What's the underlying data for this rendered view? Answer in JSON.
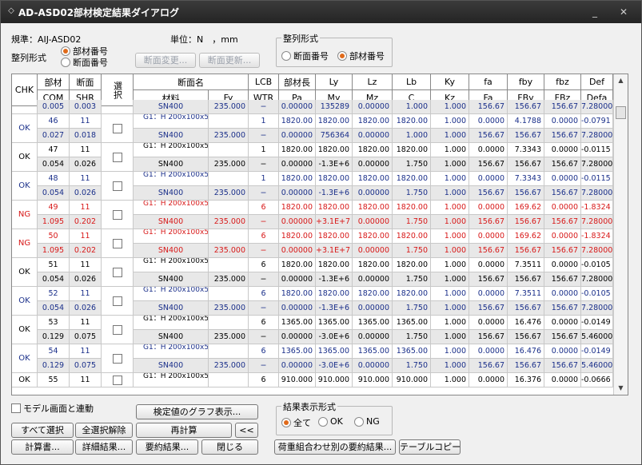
{
  "window": {
    "title": "AD-ASD02部材検定結果ダイアログ"
  },
  "top": {
    "standard": "規準：AIJ-ASD02",
    "unit": "単位：N　，mm",
    "sort_label": "整列形式",
    "radio1": "部材番号",
    "radio2": "断面番号",
    "btn_change": "断面変更...",
    "btn_update": "断面更新..."
  },
  "sortgroup": {
    "label": "整列形式",
    "opt1": "断面番号",
    "opt2": "部材番号",
    "selected": "部材番号"
  },
  "headers": {
    "top": [
      "CHK",
      "部材",
      "断面",
      "選択",
      "断面名",
      "LCB",
      "部材長",
      "Ly",
      "Lz",
      "Lb",
      "Ky",
      "fa",
      "fby",
      "fbz",
      "Def"
    ],
    "bottom": [
      "COM",
      "SHR",
      "材料",
      "Fy",
      "WTR",
      "Pa",
      "My",
      "Mz",
      "C",
      "Kz",
      "Fa",
      "FBy",
      "FBz",
      "Defa"
    ]
  },
  "rows": [
    {
      "chk": "",
      "color": "blue",
      "a": {
        "mem": "0.005",
        "sec": "0.003",
        "name": "SN400",
        "fy": "235.000",
        "lcb": "−",
        "l": "0.00000",
        "ly": "135289",
        "lz": "0.00000",
        "lb": "1.000",
        "ky": "1.000",
        "fa": "156.67",
        "fby": "156.67",
        "fbz": "156.67",
        "def": "7.28000"
      },
      "partial": true
    },
    {
      "chk": "OK",
      "color": "blue",
      "a": {
        "mem": "46",
        "sec": "11",
        "name": "G1：H 200x100x5.5/8, H=200x100x5.5x8",
        "fy": "",
        "lcb": "1",
        "l": "1820.00",
        "ly": "1820.00",
        "lz": "1820.00",
        "lb": "1820.00",
        "ky": "1.000",
        "fa": "0.0000",
        "fby": "4.1788",
        "fbz": "0.0000",
        "def": "-0.0791"
      },
      "b": {
        "mem": "0.027",
        "sec": "0.018",
        "name": "SN400",
        "fy": "235.000",
        "lcb": "−",
        "l": "0.00000",
        "ly": "756364",
        "lz": "0.00000",
        "lb": "1.000",
        "ky": "1.000",
        "fa": "156.67",
        "fby": "156.67",
        "fbz": "156.67",
        "def": "7.28000"
      }
    },
    {
      "chk": "OK",
      "color": "black",
      "a": {
        "mem": "47",
        "sec": "11",
        "name": "G1：H 200x100x5.5/8, H=200x100x5.5x8",
        "fy": "",
        "lcb": "1",
        "l": "1820.00",
        "ly": "1820.00",
        "lz": "1820.00",
        "lb": "1820.00",
        "ky": "1.000",
        "fa": "0.0000",
        "fby": "7.3343",
        "fbz": "0.0000",
        "def": "-0.0115"
      },
      "b": {
        "mem": "0.054",
        "sec": "0.026",
        "name": "SN400",
        "fy": "235.000",
        "lcb": "−",
        "l": "0.00000",
        "ly": "-1.3E+6",
        "lz": "0.00000",
        "lb": "1.750",
        "ky": "1.000",
        "fa": "156.67",
        "fby": "156.67",
        "fbz": "156.67",
        "def": "7.28000"
      }
    },
    {
      "chk": "OK",
      "color": "blue",
      "a": {
        "mem": "48",
        "sec": "11",
        "name": "G1：H 200x100x5.5/8, H=200x100x5.5x8",
        "fy": "",
        "lcb": "1",
        "l": "1820.00",
        "ly": "1820.00",
        "lz": "1820.00",
        "lb": "1820.00",
        "ky": "1.000",
        "fa": "0.0000",
        "fby": "7.3343",
        "fbz": "0.0000",
        "def": "-0.0115"
      },
      "b": {
        "mem": "0.054",
        "sec": "0.026",
        "name": "SN400",
        "fy": "235.000",
        "lcb": "−",
        "l": "0.00000",
        "ly": "-1.3E+6",
        "lz": "0.00000",
        "lb": "1.750",
        "ky": "1.000",
        "fa": "156.67",
        "fby": "156.67",
        "fbz": "156.67",
        "def": "7.28000"
      }
    },
    {
      "chk": "NG",
      "color": "red",
      "a": {
        "mem": "49",
        "sec": "11",
        "name": "G1：H 200x100x5.5/8, H=200x100x5.5x8",
        "fy": "",
        "lcb": "6",
        "l": "1820.00",
        "ly": "1820.00",
        "lz": "1820.00",
        "lb": "1820.00",
        "ky": "1.000",
        "fa": "0.0000",
        "fby": "169.62",
        "fbz": "0.0000",
        "def": "-1.8324"
      },
      "b": {
        "mem": "1.095",
        "sec": "0.202",
        "name": "SN400",
        "fy": "235.000",
        "lcb": "−",
        "l": "0.00000",
        "ly": "+3.1E+7",
        "lz": "0.00000",
        "lb": "1.750",
        "ky": "1.000",
        "fa": "156.67",
        "fby": "156.67",
        "fbz": "156.67",
        "def": "7.28000"
      }
    },
    {
      "chk": "NG",
      "color": "red",
      "a": {
        "mem": "50",
        "sec": "11",
        "name": "G1：H 200x100x5.5/8, H=200x100x5.5x8",
        "fy": "",
        "lcb": "6",
        "l": "1820.00",
        "ly": "1820.00",
        "lz": "1820.00",
        "lb": "1820.00",
        "ky": "1.000",
        "fa": "0.0000",
        "fby": "169.62",
        "fbz": "0.0000",
        "def": "-1.8324"
      },
      "b": {
        "mem": "1.095",
        "sec": "0.202",
        "name": "SN400",
        "fy": "235.000",
        "lcb": "−",
        "l": "0.00000",
        "ly": "+3.1E+7",
        "lz": "0.00000",
        "lb": "1.750",
        "ky": "1.000",
        "fa": "156.67",
        "fby": "156.67",
        "fbz": "156.67",
        "def": "7.28000"
      }
    },
    {
      "chk": "OK",
      "color": "black",
      "a": {
        "mem": "51",
        "sec": "11",
        "name": "G1：H 200x100x5.5/8, H=200x100x5.5x8",
        "fy": "",
        "lcb": "6",
        "l": "1820.00",
        "ly": "1820.00",
        "lz": "1820.00",
        "lb": "1820.00",
        "ky": "1.000",
        "fa": "0.0000",
        "fby": "7.3511",
        "fbz": "0.0000",
        "def": "-0.0105"
      },
      "b": {
        "mem": "0.054",
        "sec": "0.026",
        "name": "SN400",
        "fy": "235.000",
        "lcb": "−",
        "l": "0.00000",
        "ly": "-1.3E+6",
        "lz": "0.00000",
        "lb": "1.750",
        "ky": "1.000",
        "fa": "156.67",
        "fby": "156.67",
        "fbz": "156.67",
        "def": "7.28000"
      }
    },
    {
      "chk": "OK",
      "color": "blue",
      "a": {
        "mem": "52",
        "sec": "11",
        "name": "G1：H 200x100x5.5/8, H=200x100x5.5x8",
        "fy": "",
        "lcb": "6",
        "l": "1820.00",
        "ly": "1820.00",
        "lz": "1820.00",
        "lb": "1820.00",
        "ky": "1.000",
        "fa": "0.0000",
        "fby": "7.3511",
        "fbz": "0.0000",
        "def": "-0.0105"
      },
      "b": {
        "mem": "0.054",
        "sec": "0.026",
        "name": "SN400",
        "fy": "235.000",
        "lcb": "−",
        "l": "0.00000",
        "ly": "-1.3E+6",
        "lz": "0.00000",
        "lb": "1.750",
        "ky": "1.000",
        "fa": "156.67",
        "fby": "156.67",
        "fbz": "156.67",
        "def": "7.28000"
      }
    },
    {
      "chk": "OK",
      "color": "black",
      "a": {
        "mem": "53",
        "sec": "11",
        "name": "G1：H 200x100x5.5/8, H=200x100x5.5x8",
        "fy": "",
        "lcb": "6",
        "l": "1365.00",
        "ly": "1365.00",
        "lz": "1365.00",
        "lb": "1365.00",
        "ky": "1.000",
        "fa": "0.0000",
        "fby": "16.476",
        "fbz": "0.0000",
        "def": "-0.0149"
      },
      "b": {
        "mem": "0.129",
        "sec": "0.075",
        "name": "SN400",
        "fy": "235.000",
        "lcb": "−",
        "l": "0.00000",
        "ly": "-3.0E+6",
        "lz": "0.00000",
        "lb": "1.750",
        "ky": "1.000",
        "fa": "156.67",
        "fby": "156.67",
        "fbz": "156.67",
        "def": "5.46000"
      }
    },
    {
      "chk": "OK",
      "color": "blue",
      "a": {
        "mem": "54",
        "sec": "11",
        "name": "G1：H 200x100x5.5/8, H=200x100x5.5x8",
        "fy": "",
        "lcb": "6",
        "l": "1365.00",
        "ly": "1365.00",
        "lz": "1365.00",
        "lb": "1365.00",
        "ky": "1.000",
        "fa": "0.0000",
        "fby": "16.476",
        "fbz": "0.0000",
        "def": "-0.0149"
      },
      "b": {
        "mem": "0.129",
        "sec": "0.075",
        "name": "SN400",
        "fy": "235.000",
        "lcb": "−",
        "l": "0.00000",
        "ly": "-3.0E+6",
        "lz": "0.00000",
        "lb": "1.750",
        "ky": "1.000",
        "fa": "156.67",
        "fby": "156.67",
        "fbz": "156.67",
        "def": "5.46000"
      }
    },
    {
      "chk": "OK",
      "color": "black",
      "a": {
        "mem": "55",
        "sec": "11",
        "name": "G1：H 200x100x5.5/8, H=200x100x5.5x8",
        "fy": "",
        "lcb": "6",
        "l": "910.000",
        "ly": "910.000",
        "lz": "910.000",
        "lb": "910.000",
        "ky": "1.000",
        "fa": "0.0000",
        "fby": "16.376",
        "fbz": "0.0000",
        "def": "-0.0666"
      },
      "partialB": true
    }
  ],
  "bottom": {
    "link_model": "モデル画面と連動",
    "btn_graph": "検定値のグラフ表示...",
    "btn_select_all": "すべて選択",
    "btn_unselect_all": "全選択解除",
    "btn_recalc": "再計算",
    "btn_back": "<<",
    "btn_calc_doc": "計算書...",
    "btn_detail": "詳細結果...",
    "btn_summary": "要約結果...",
    "btn_close": "閉じる",
    "result_group": "結果表示形式",
    "res_all": "全て",
    "res_ok": "OK",
    "res_ng": "NG",
    "btn_lc_summary": "荷重組合わせ別の要約結果...",
    "btn_table_copy": "テーブルコピー"
  },
  "colors": {
    "blue": "#1a2f8a",
    "red": "#d81818",
    "accent": "#e06a1a"
  }
}
